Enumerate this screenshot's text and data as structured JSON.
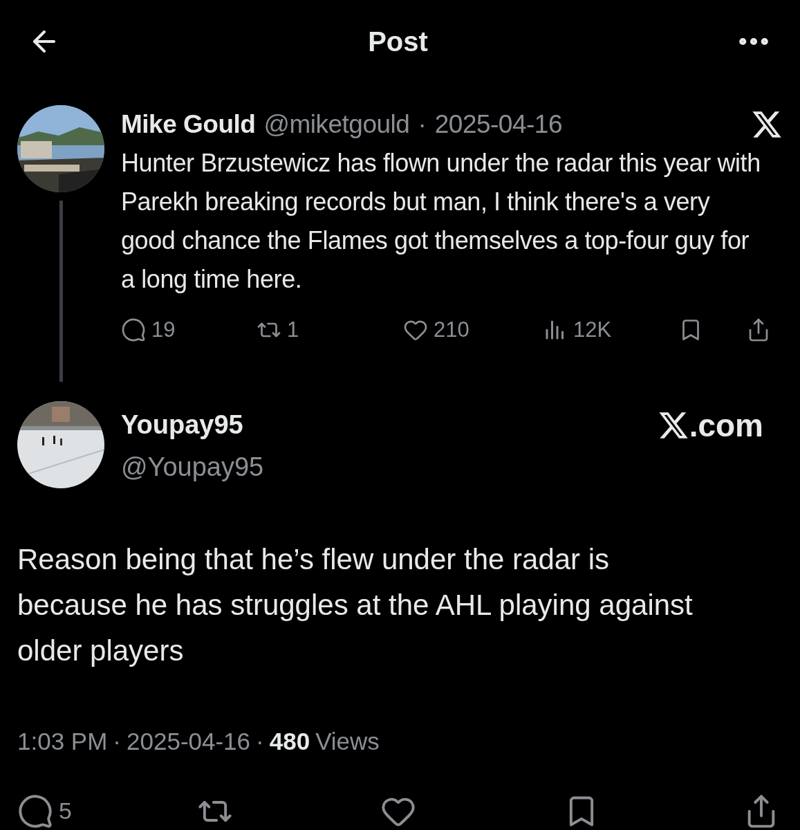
{
  "header": {
    "title": "Post"
  },
  "quoted_post": {
    "author": "Mike Gould",
    "handle": "@miketgould",
    "separator": "·",
    "date": "2025-04-16",
    "text": "Hunter Brzustewicz has flown under the radar this year with Parekh breaking records but man, I think there's a very good chance the Flames got themselves a top-four guy for a long time here.",
    "actions": [
      {
        "kind": "reply",
        "count": "19"
      },
      {
        "kind": "repost",
        "count": "1"
      },
      {
        "kind": "like",
        "count": "210"
      },
      {
        "kind": "views",
        "count": "12K"
      },
      {
        "kind": "bookmark"
      },
      {
        "kind": "share"
      }
    ]
  },
  "reply": {
    "author": "Youpay95",
    "handle": "@Youpay95",
    "source_suffix": ".com",
    "text": "Reason being that he’s flew under the radar is because he has struggles at the AHL playing against older players",
    "time": "1:03 PM",
    "separator_1": "·",
    "date": "2025-04-16",
    "separator_2": "·",
    "views_count": "480",
    "views_label": "Views",
    "actions": [
      {
        "kind": "reply",
        "count": "5"
      },
      {
        "kind": "repost"
      },
      {
        "kind": "like"
      },
      {
        "kind": "bookmark"
      },
      {
        "kind": "share"
      }
    ]
  }
}
